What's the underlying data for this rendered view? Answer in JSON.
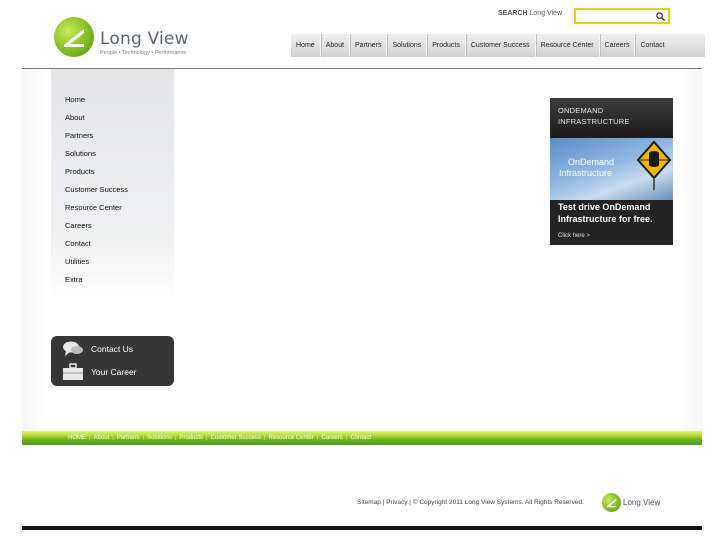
{
  "brand": {
    "name": "Long View",
    "tagline": "People  •  Technology  •  Performance",
    "primary_color": "#7cb820"
  },
  "search": {
    "label_bold": "SEARCH",
    "label_rest": "Long View",
    "value": "",
    "icon": "search-icon"
  },
  "topnav": {
    "items": [
      "Home",
      "About",
      "Partners",
      "Solutions",
      "Products",
      "Customer Success",
      "Resource Center",
      "Careers",
      "Contact"
    ]
  },
  "sidebar": {
    "items": [
      "Home",
      "About",
      "Partners",
      "Solutions",
      "Products",
      "Customer Success",
      "Resource Center",
      "Careers",
      "Contact",
      "Utilities",
      "Extra"
    ]
  },
  "quicklinks": {
    "contact": {
      "label": "Contact Us",
      "icon": "speech-bubbles-icon"
    },
    "career": {
      "label": "Your Career",
      "icon": "briefcase-icon"
    }
  },
  "ad": {
    "heading_line1": "ONDEMAND",
    "heading_line2": "INFRASTRUCTURE",
    "image_line1": "OnDemand",
    "image_line2": "Infrastructure",
    "tagline_line1": "Test drive OnDemand",
    "tagline_line2": "Infrastructure for free.",
    "cta": "Click here >"
  },
  "footer": {
    "nav": [
      "HOME",
      "About",
      "Partners",
      "Solutions",
      "Products",
      "Customer Success",
      "Resource Center",
      "Careers",
      "Contact"
    ],
    "separator": "|",
    "copyright": "Sitemap | Privacy | © Copyright 2011 Long View Systems. All Rights Reserved.",
    "logo_text": "Long View",
    "bar_color": "#6fb524"
  }
}
